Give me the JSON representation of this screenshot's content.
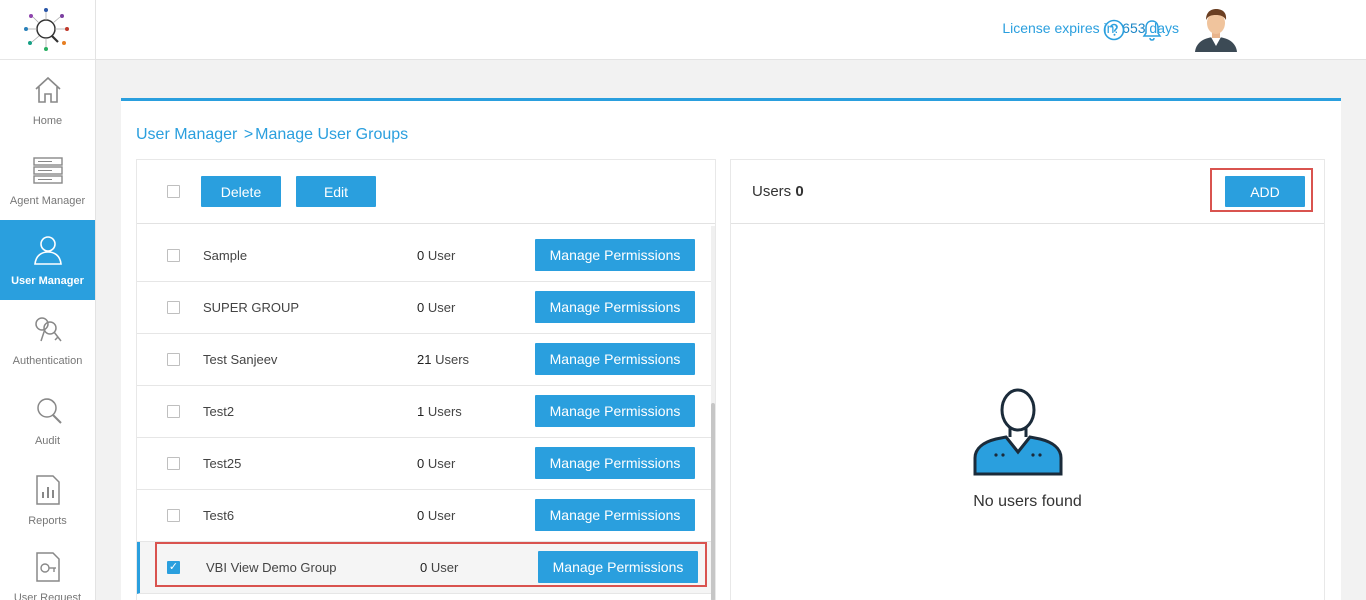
{
  "sidebar": {
    "items": [
      {
        "label": "Home",
        "icon": "home-icon"
      },
      {
        "label": "Agent Manager",
        "icon": "server-icon"
      },
      {
        "label": "User Manager",
        "icon": "user-icon",
        "active": true
      },
      {
        "label": "Authentication",
        "icon": "keys-icon"
      },
      {
        "label": "Audit",
        "icon": "audit-icon"
      },
      {
        "label": "Reports",
        "icon": "report-icon"
      },
      {
        "label": "User Request",
        "icon": "user-request-icon"
      }
    ]
  },
  "header": {
    "license_prefix": "License expires in:",
    "license_days": "653",
    "license_suffix": "days"
  },
  "breadcrumb": {
    "parent": "User Manager",
    "separator": ">",
    "current": "Manage User Groups"
  },
  "left_panel": {
    "delete_label": "Delete",
    "edit_label": "Edit",
    "groups": [
      {
        "name": "Sample",
        "count": "0",
        "unit": "User",
        "button": "Manage Permissions",
        "checked": false
      },
      {
        "name": "SUPER GROUP",
        "count": "0",
        "unit": "User",
        "button": "Manage Permissions",
        "checked": false
      },
      {
        "name": "Test Sanjeev",
        "count": "21",
        "unit": "Users",
        "button": "Manage Permissions",
        "checked": false
      },
      {
        "name": "Test2",
        "count": "1",
        "unit": "Users",
        "button": "Manage Permissions",
        "checked": false
      },
      {
        "name": "Test25",
        "count": "0",
        "unit": "User",
        "button": "Manage Permissions",
        "checked": false
      },
      {
        "name": "Test6",
        "count": "0",
        "unit": "User",
        "button": "Manage Permissions",
        "checked": false
      },
      {
        "name": "VBI View Demo Group",
        "count": "0",
        "unit": "User",
        "button": "Manage Permissions",
        "checked": true
      }
    ]
  },
  "right_panel": {
    "title_prefix": "Users",
    "user_count": "0",
    "add_label": "ADD",
    "empty_text": "No users found"
  },
  "colors": {
    "accent": "#2a9fde",
    "highlight": "#d9534f"
  }
}
